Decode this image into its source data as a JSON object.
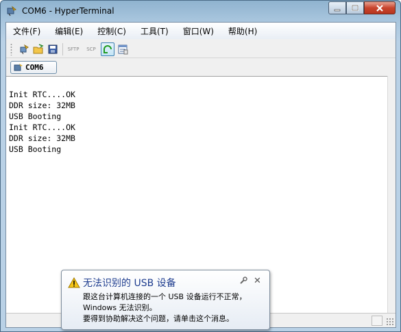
{
  "window": {
    "title": "COM6 - HyperTerminal"
  },
  "menu": {
    "items": [
      "文件(F)",
      "编辑(E)",
      "控制(C)",
      "工具(T)",
      "窗口(W)",
      "帮助(H)"
    ]
  },
  "toolbar": {
    "sftp_label": "SFTP",
    "scp_label": "SCP"
  },
  "tabs": [
    {
      "label": "COM6",
      "active": true
    }
  ],
  "terminal": {
    "lines": [
      "Init RTC....OK",
      "DDR size: 32MB",
      "USB Booting",
      "Init RTC....OK",
      "DDR size: 32MB",
      "USB Booting"
    ]
  },
  "notification": {
    "title": "无法识别的 USB 设备",
    "body_lines": [
      "跟这台计算机连接的一个 USB 设备运行不正常，",
      "Windows 无法识别。",
      "要得到协助解决这个问题，请单击这个消息。"
    ],
    "close_glyph": "✕"
  },
  "colors": {
    "accent": "#1e3d8f",
    "close_button": "#c8452e"
  }
}
